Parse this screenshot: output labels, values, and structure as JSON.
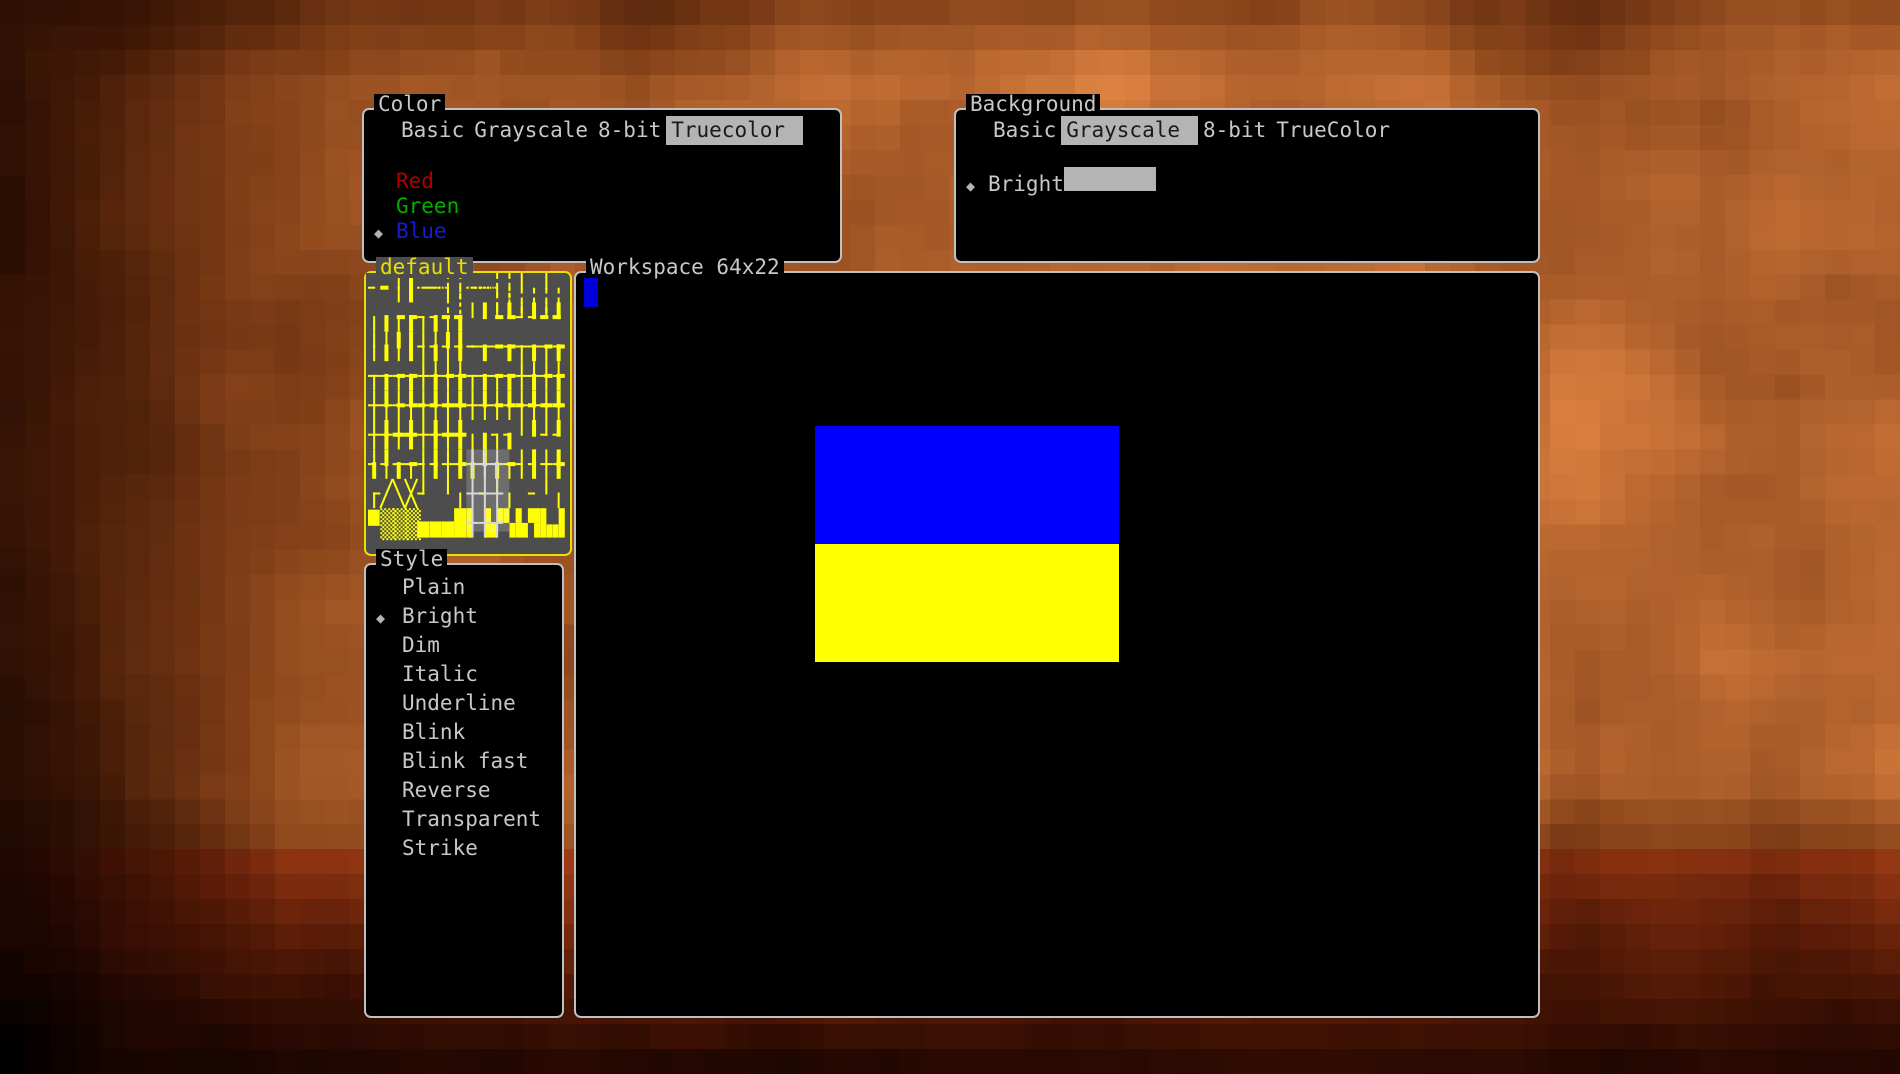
{
  "app": {
    "kind": "terminal-ansi-art-editor",
    "backdrop_description": "pixelated warm orange and brown photograph"
  },
  "colors": {
    "panel_border": "#c0c0c0",
    "panel_background": "#000000",
    "palette_border": "#e8e000",
    "palette_background": "#4d4d4d",
    "palette_glyph": "#ffff00",
    "text": "#c8c8c8",
    "selection_background": "#b4b4b4",
    "selection_text": "#1a1a1a",
    "red": "#b00000",
    "green": "#00b000",
    "blue": "#1a1ad2",
    "cursor_blue": "#0000d8",
    "flag_blue": "#0000ff",
    "flag_yellow": "#ffff00"
  },
  "color_panel": {
    "title": "Color",
    "modes": [
      {
        "label": "Basic",
        "selected": false
      },
      {
        "label": "Grayscale",
        "selected": false
      },
      {
        "label": "8-bit",
        "selected": false
      },
      {
        "label": "Truecolor",
        "selected": true
      }
    ],
    "options": [
      {
        "label": "Red",
        "selected": false,
        "swatch": "red"
      },
      {
        "label": "Green",
        "selected": false,
        "swatch": "green"
      },
      {
        "label": "Blue",
        "selected": true,
        "swatch": "blue"
      }
    ],
    "marker": "◆"
  },
  "background_panel": {
    "title": "Background",
    "modes": [
      {
        "label": "Basic",
        "selected": false
      },
      {
        "label": "Grayscale",
        "selected": true
      },
      {
        "label": "8-bit",
        "selected": false
      },
      {
        "label": "TrueColor",
        "selected": false
      }
    ],
    "options": [
      {
        "label": "Bright",
        "selected": true,
        "swatch": "gray-bar"
      }
    ],
    "marker": "◆"
  },
  "palette_panel": {
    "title": "default"
  },
  "style_panel": {
    "title": "Style",
    "marker": "◆",
    "options": [
      {
        "label": "Plain",
        "selected": false
      },
      {
        "label": "Bright",
        "selected": true
      },
      {
        "label": "Dim",
        "selected": false
      },
      {
        "label": "Italic",
        "selected": false
      },
      {
        "label": "Underline",
        "selected": false
      },
      {
        "label": "Blink",
        "selected": false
      },
      {
        "label": "Blink fast",
        "selected": false
      },
      {
        "label": "Reverse",
        "selected": false
      },
      {
        "label": "Transparent",
        "selected": false
      },
      {
        "label": "Strike",
        "selected": false
      }
    ]
  },
  "workspace_panel": {
    "title": "Workspace 64x22",
    "columns": 64,
    "rows": 22,
    "cursor": {
      "col": 0,
      "row": 0
    },
    "artwork": {
      "name": "ukraine-flag",
      "left_col": 16,
      "top_row": 5,
      "width_cols": 21,
      "height_rows": 8,
      "stripes": [
        {
          "color": "#0000ff",
          "rows": 4
        },
        {
          "color": "#ffff00",
          "rows": 4
        }
      ]
    }
  }
}
